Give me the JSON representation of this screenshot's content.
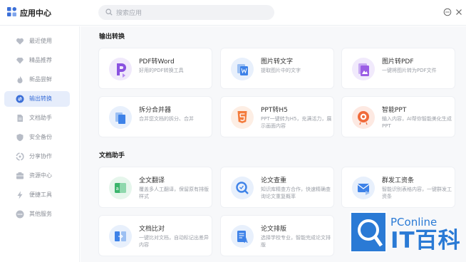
{
  "app": {
    "title": "应用中心"
  },
  "search": {
    "placeholder": "搜索应用"
  },
  "icons": {
    "logo": "grid-logo-icon",
    "search": "search-icon",
    "message": "chat-bubble-icon",
    "close": "close-icon"
  },
  "sidebar": {
    "items": [
      {
        "label": "最近使用",
        "icon": "heart-icon",
        "active": false
      },
      {
        "label": "精品推荐",
        "icon": "diamond-icon",
        "active": false
      },
      {
        "label": "新品尝鲜",
        "icon": "fire-icon",
        "active": false
      },
      {
        "label": "输出转换",
        "icon": "convert-icon",
        "active": true
      },
      {
        "label": "文档助手",
        "icon": "document-icon",
        "active": false
      },
      {
        "label": "安全备份",
        "icon": "shield-icon",
        "active": false
      },
      {
        "label": "分享协作",
        "icon": "share-icon",
        "active": false
      },
      {
        "label": "资源中心",
        "icon": "resource-icon",
        "active": false
      },
      {
        "label": "便捷工具",
        "icon": "lightning-icon",
        "active": false
      },
      {
        "label": "其他服务",
        "icon": "more-dots-icon",
        "active": false
      }
    ]
  },
  "sections": [
    {
      "title": "输出转换",
      "cards": [
        {
          "title": "PDF转Word",
          "desc": "好用的PDF转换工具",
          "icon": "pdf-to-word-icon",
          "color": "#8a52e0"
        },
        {
          "title": "图片转文字",
          "desc": "提取图片中的文字",
          "icon": "image-to-text-icon",
          "color": "#3e82e8"
        },
        {
          "title": "图片转PDF",
          "desc": "一键将图片转为PDF文件",
          "icon": "image-to-pdf-icon",
          "color": "#9b5de5"
        },
        {
          "title": "拆分合并器",
          "desc": "合并您文档的拆分、合并",
          "icon": "split-merge-icon",
          "color": "#3e82e8"
        },
        {
          "title": "PPT转H5",
          "desc": "PPT一键转为H5，充满活力，展示画面内容",
          "icon": "html5-icon",
          "color": "#f37b3c"
        },
        {
          "title": "智能PPT",
          "desc": "输入内容，AI帮你智能美化生成PPT",
          "icon": "smart-ppt-icon",
          "color": "#f06a3a"
        }
      ]
    },
    {
      "title": "文档助手",
      "cards": [
        {
          "title": "全文翻译",
          "desc": "覆盖多人工翻译，保留原有排版样式",
          "icon": "translate-icon",
          "color": "#3bb56c"
        },
        {
          "title": "论文查重",
          "desc": "知识库精查方合作，快速精确查询论文重复概率",
          "icon": "plagiarism-check-icon",
          "color": "#3e82e8"
        },
        {
          "title": "群发工资条",
          "desc": "智能识别表格内容，一键群发工资条",
          "icon": "payslip-icon",
          "color": "#3e82e8"
        },
        {
          "title": "文档比对",
          "desc": "一键比对文档，自动标记出差异内容",
          "icon": "compare-icon",
          "color": "#3e82e8"
        },
        {
          "title": "论文排版",
          "desc": "选择学校专业，智能完成论文排版",
          "icon": "paper-layout-icon",
          "color": "#3e82e8"
        }
      ]
    }
  ],
  "watermark": {
    "top": "PConline",
    "bottom": "IT百科"
  }
}
